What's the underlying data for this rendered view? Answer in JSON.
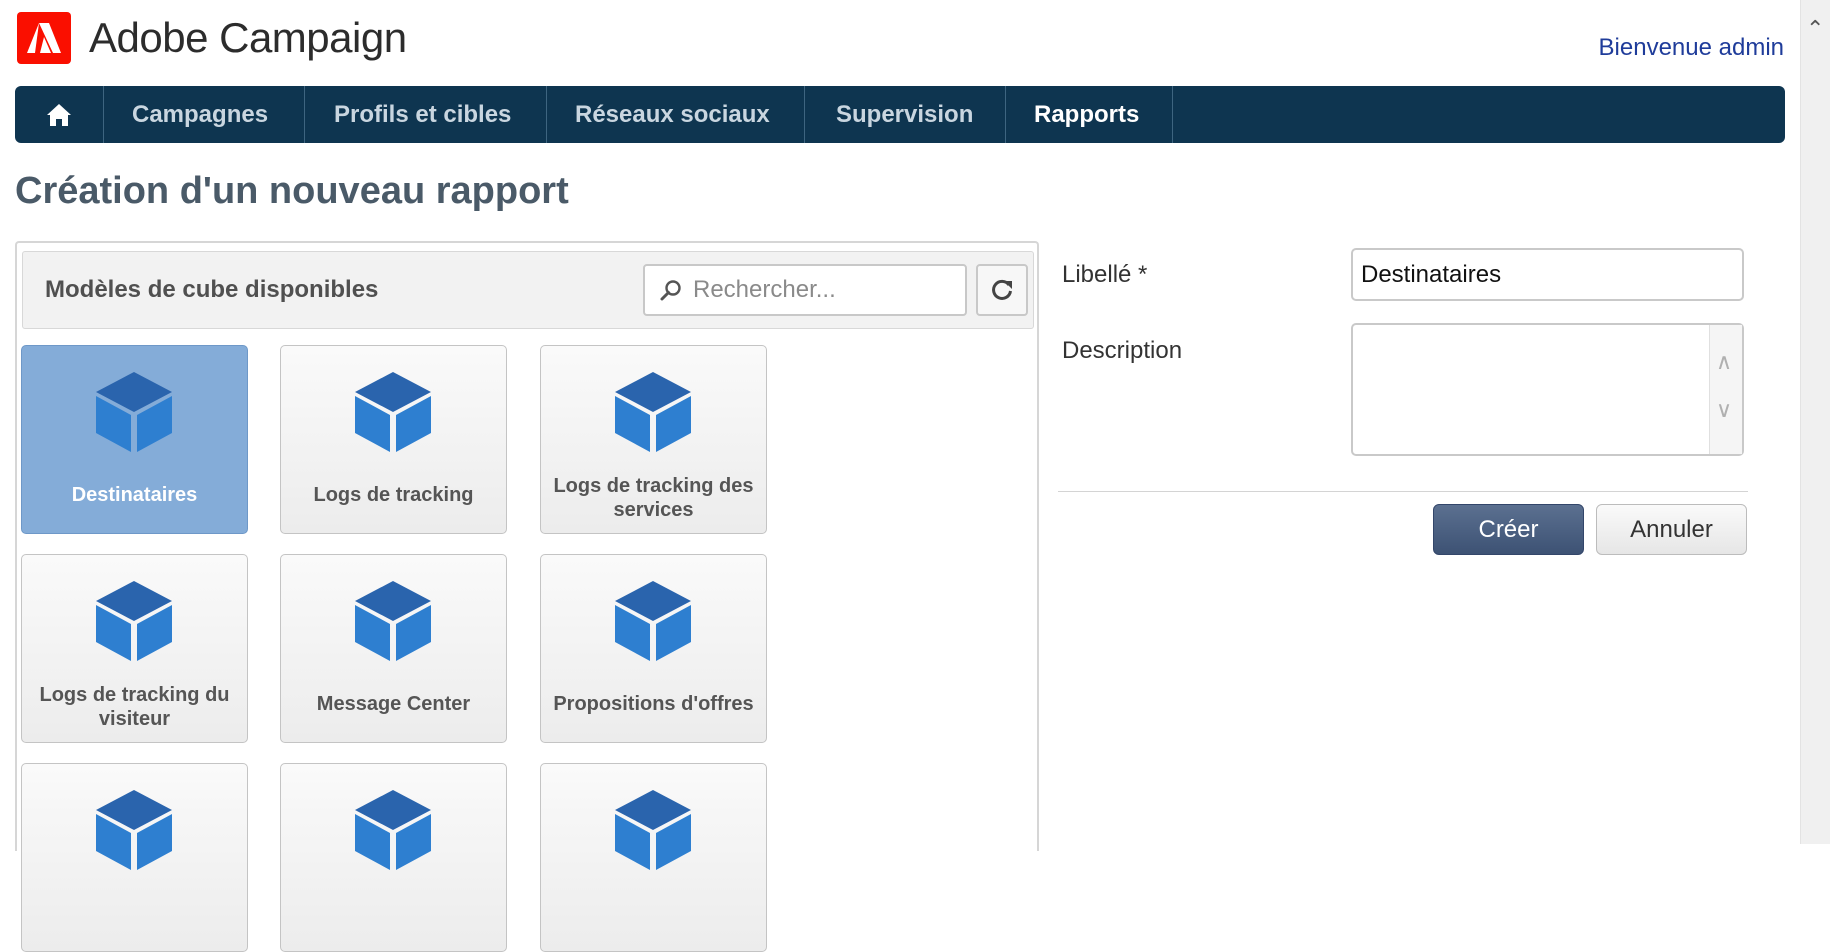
{
  "header": {
    "app_name": "Adobe Campaign",
    "logo_icon": "adobe-logo-icon",
    "welcome": "Bienvenue admin"
  },
  "nav": {
    "home_icon": "home-icon",
    "items": [
      {
        "label": "Campagnes",
        "active": false
      },
      {
        "label": "Profils et cibles",
        "active": false
      },
      {
        "label": "Réseaux sociaux",
        "active": false
      },
      {
        "label": "Supervision",
        "active": false
      },
      {
        "label": "Rapports",
        "active": true
      }
    ]
  },
  "page": {
    "title": "Création d'un nouveau rapport"
  },
  "cube_panel": {
    "title": "Modèles de cube disponibles",
    "search_placeholder": "Rechercher...",
    "search_icon": "search-icon",
    "refresh_icon": "refresh-icon",
    "tiles": [
      {
        "label": "Destinataires",
        "selected": true,
        "icon": "cube-icon"
      },
      {
        "label": "Logs de tracking",
        "selected": false,
        "icon": "cube-icon"
      },
      {
        "label": "Logs de tracking des services",
        "selected": false,
        "icon": "cube-icon"
      },
      {
        "label": "Logs de tracking du visiteur",
        "selected": false,
        "icon": "cube-icon"
      },
      {
        "label": "Message Center",
        "selected": false,
        "icon": "cube-icon"
      },
      {
        "label": "Propositions d'offres",
        "selected": false,
        "icon": "cube-icon"
      },
      {
        "label": "",
        "selected": false,
        "icon": "cube-icon"
      },
      {
        "label": "",
        "selected": false,
        "icon": "cube-icon"
      },
      {
        "label": "",
        "selected": false,
        "icon": "cube-icon"
      }
    ]
  },
  "form": {
    "label_field": "Libellé *",
    "label_value": "Destinataires",
    "description_field": "Description",
    "description_value": "",
    "create_button": "Créer",
    "cancel_button": "Annuler"
  },
  "colors": {
    "nav_bg": "#0e3550",
    "selected_tile": "#84acd8",
    "cube_blue": "#2e7fd0",
    "adobe_red": "#fa0f00",
    "welcome_link": "#1f3c9a"
  }
}
